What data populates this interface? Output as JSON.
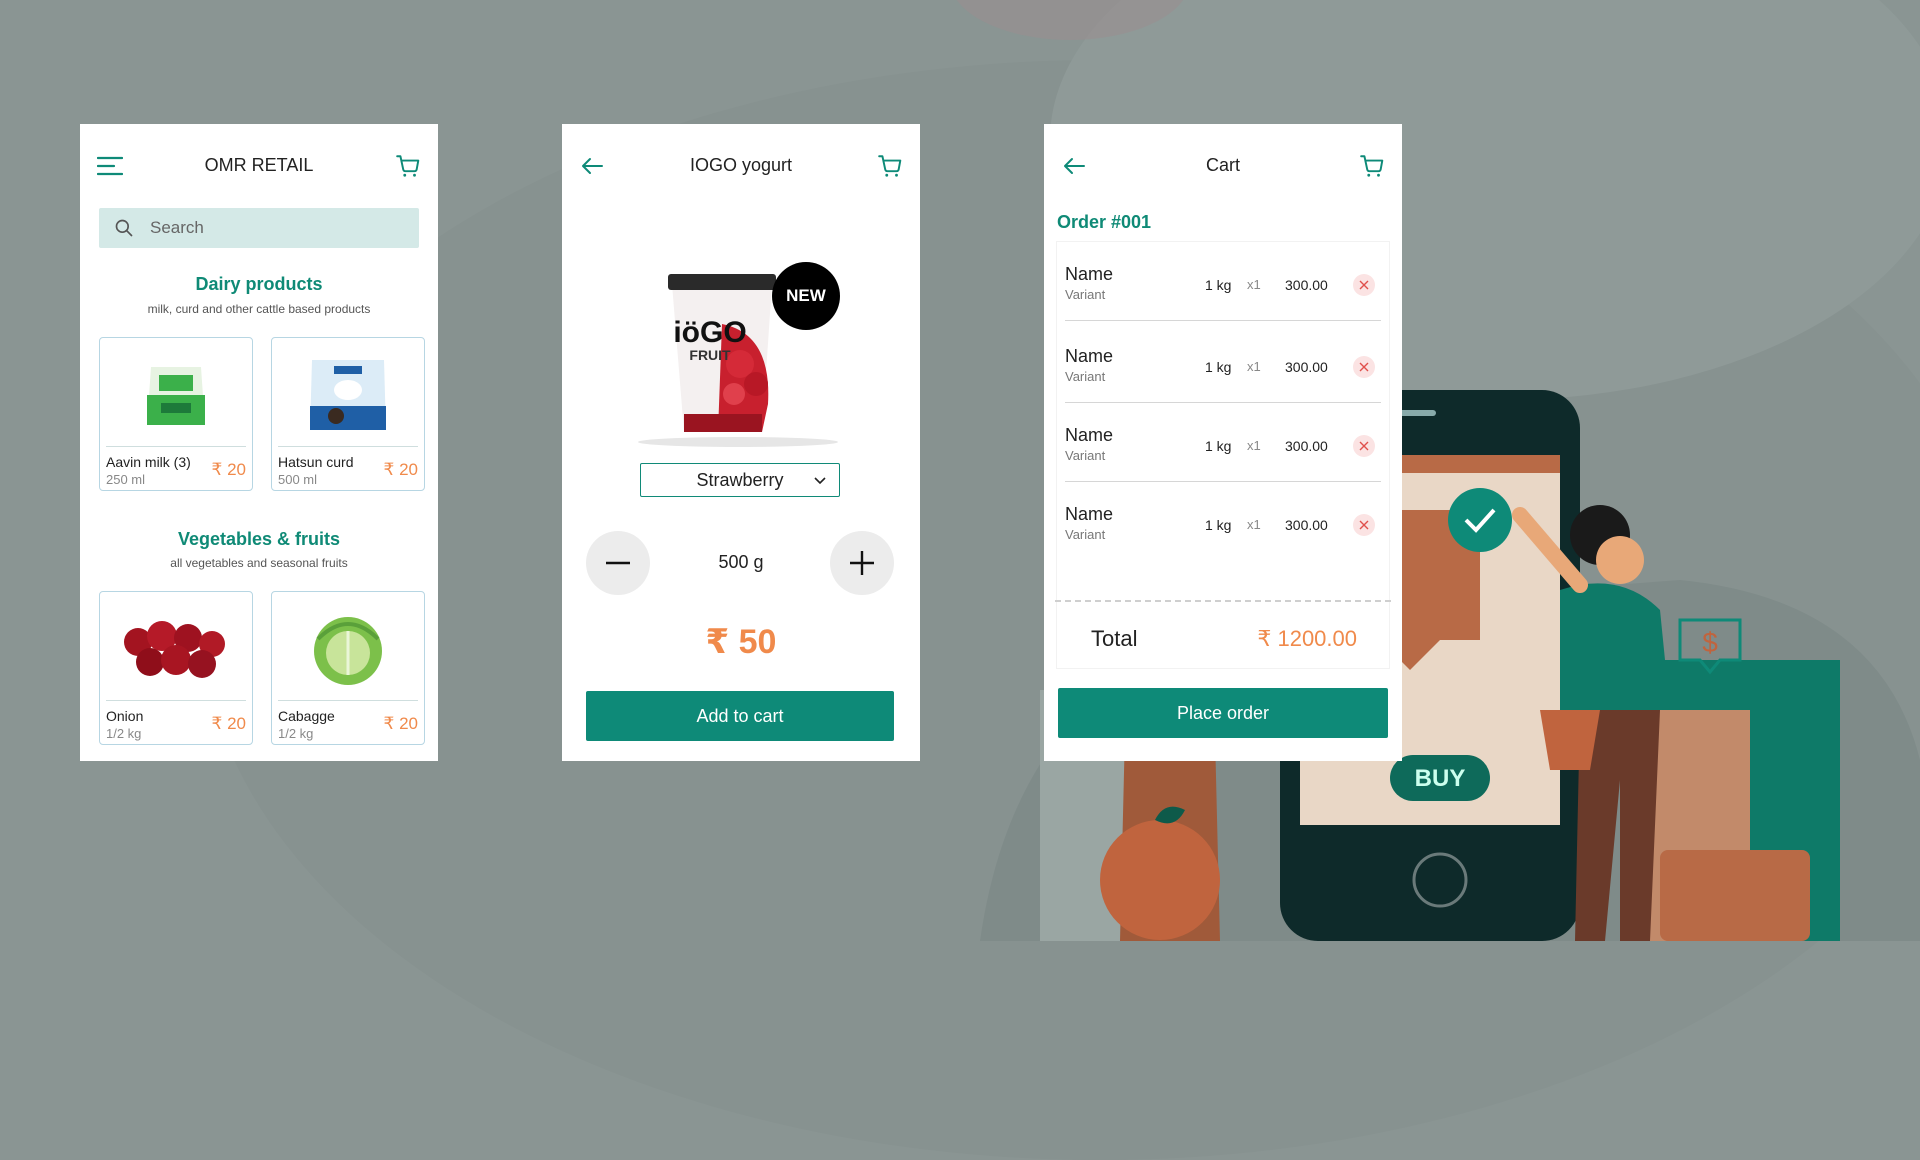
{
  "colors": {
    "accent": "#0e8a78",
    "price": "#f08a4b",
    "search_bg": "#d4e9e7",
    "background": "#8a9593"
  },
  "home": {
    "title": "OMR RETAIL",
    "menu_icon": "hamburger-menu-icon",
    "cart_icon": "cart-icon",
    "search": {
      "placeholder": "Search",
      "icon": "search-icon"
    },
    "sections": [
      {
        "title": "Dairy products",
        "subtitle": "milk, curd and other cattle based products",
        "products": [
          {
            "name": "Aavin milk (3)",
            "qty": "250 ml",
            "price": "₹ 20"
          },
          {
            "name": "Hatsun curd",
            "qty": "500 ml",
            "price": "₹ 20"
          }
        ]
      },
      {
        "title": "Vegetables & fruits",
        "subtitle": "all vegetables and seasonal fruits",
        "products": [
          {
            "name": "Onion",
            "qty": "1/2 kg",
            "price": "₹ 20"
          },
          {
            "name": "Cabagge",
            "qty": "1/2 kg",
            "price": "₹ 20"
          }
        ]
      }
    ]
  },
  "product": {
    "title": "IOGO yogurt",
    "badge": "NEW",
    "brand_text": "iöGO",
    "brand_sub": "FRUIT",
    "variant": "Strawberry",
    "quantity": "500 g",
    "price": "₹ 50",
    "add_to_cart": "Add to cart"
  },
  "cart": {
    "title": "Cart",
    "order": "Order #001",
    "items": [
      {
        "name": "Name",
        "variant": "Variant",
        "weight": "1 kg",
        "count": "x1",
        "price": "300.00"
      },
      {
        "name": "Name",
        "variant": "Variant",
        "weight": "1 kg",
        "count": "x1",
        "price": "300.00"
      },
      {
        "name": "Name",
        "variant": "Variant",
        "weight": "1 kg",
        "count": "x1",
        "price": "300.00"
      },
      {
        "name": "Name",
        "variant": "Variant",
        "weight": "1 kg",
        "count": "x1",
        "price": "300.00"
      }
    ],
    "total_label": "Total",
    "total_value": "₹ 1200.00",
    "place_order": "Place order"
  },
  "illustration": {
    "buy_label": "BUY",
    "dollar": "$"
  }
}
